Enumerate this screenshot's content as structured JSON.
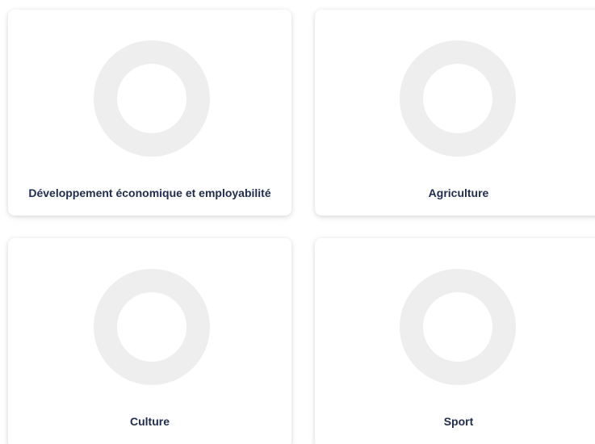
{
  "categories": [
    {
      "label": "Développement économique et employabilité",
      "icon": "circle-placeholder-icon"
    },
    {
      "label": "Agriculture",
      "icon": "circle-placeholder-icon"
    },
    {
      "label": "Culture",
      "icon": "circle-placeholder-icon"
    },
    {
      "label": "Sport",
      "icon": "circle-placeholder-icon"
    }
  ],
  "colors": {
    "label_text": "#1e2c4f",
    "placeholder_ring": "#eeeeee",
    "card_background": "#ffffff"
  }
}
